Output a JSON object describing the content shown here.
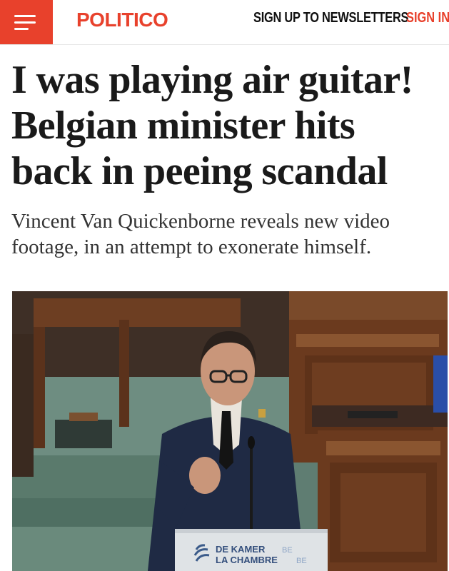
{
  "header": {
    "menu_icon": "hamburger-menu-icon",
    "logo": "POLITICO",
    "newsletter_link": "SIGN UP TO NEWSLETTERS",
    "signin_link": "SIGN IN"
  },
  "article": {
    "headline": "I was playing air guitar! Belgian minister hits back in peeing scandal",
    "dek": "Vincent Van Quickenborne reveals new video footage, in an attempt to exonerate himself."
  },
  "photo": {
    "lectern_line1": "DE KAMER",
    "lectern_line1_suffix": "BE",
    "lectern_line2": "LA CHAMBRE",
    "lectern_line2_suffix": "BE"
  },
  "colors": {
    "brand": "#e8412c",
    "text": "#1a1a1a"
  }
}
